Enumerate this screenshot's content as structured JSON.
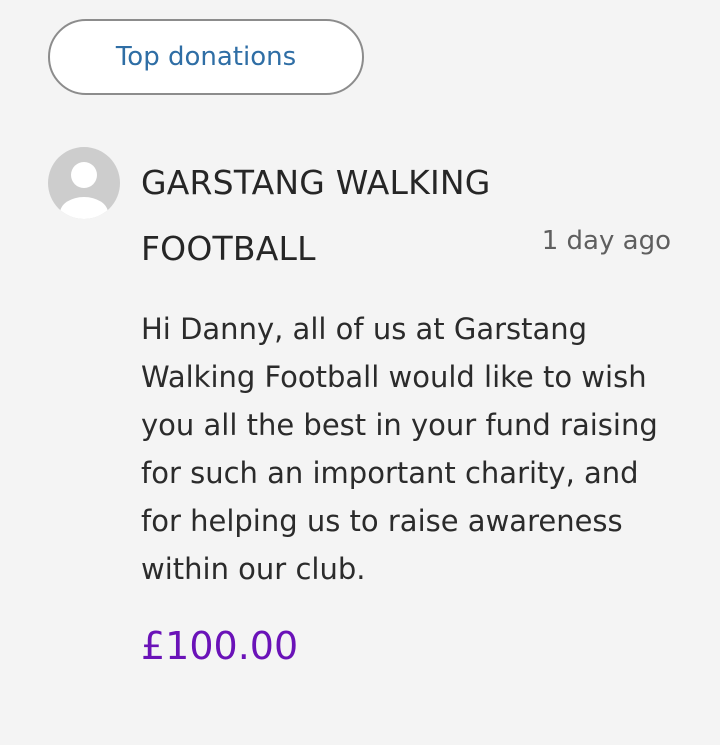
{
  "top_button": {
    "label": "Top donations"
  },
  "donation": {
    "avatar_icon": "user-avatar-icon",
    "donor_name": "GARSTANG WALKING FOOTBALL",
    "time_ago": "1 day ago",
    "message": "Hi Danny, all of us at Garstang Walking Football would like to wish you all the best in your fund raising for such an important charity, and for helping us to raise awareness within our club.",
    "amount": "£100.00"
  },
  "colors": {
    "background": "#f4f4f4",
    "button_text": "#2f6ea5",
    "amount": "#6a12b8",
    "avatar": "#cdcdcd"
  }
}
